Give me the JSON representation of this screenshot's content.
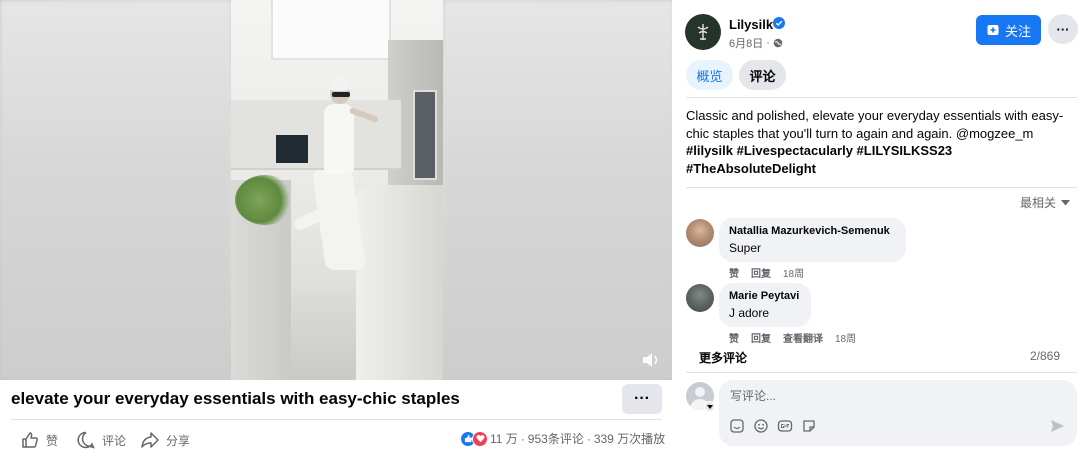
{
  "video": {
    "title": "elevate your everyday essentials with easy-chic staples",
    "more_label": "···"
  },
  "actions": {
    "like_label": "赞",
    "comment_label": "评论",
    "share_label": "分享"
  },
  "stats": {
    "reactions": "11 万",
    "comments": "953条评论",
    "views": "339 万次播放",
    "separator": "·"
  },
  "post": {
    "page_name": "Lilysilk",
    "date": "6月8日",
    "date_separator": "·",
    "follow_label": "关注",
    "more_label": "···",
    "tabs": [
      "概览",
      "评论"
    ],
    "text": "Classic and polished, elevate your everyday essentials with easy-chic staples that you'll turn to again and again. @mogzee_m",
    "hashtags": "#lilysilk #Livespectacularly #LILYSILKSS23 #TheAbsoluteDelight"
  },
  "comments": {
    "sort_label": "最相关",
    "items": [
      {
        "author": "Natallia Mazurkevich-Semenuk",
        "text": "Super",
        "like_label": "赞",
        "reply_label": "回复",
        "time": "18周"
      },
      {
        "author": "Marie Peytavi",
        "text": "J adore",
        "like_label": "赞",
        "reply_label": "回复",
        "translate_label": "查看翻译",
        "time": "18周"
      }
    ],
    "more_label": "更多评论",
    "counter": "2/869",
    "input_placeholder": "写评论..."
  },
  "colors": {
    "accent": "#1877f2",
    "love": "#f33e58",
    "bubble": "#f0f2f5",
    "secondary_text": "#65676b"
  }
}
